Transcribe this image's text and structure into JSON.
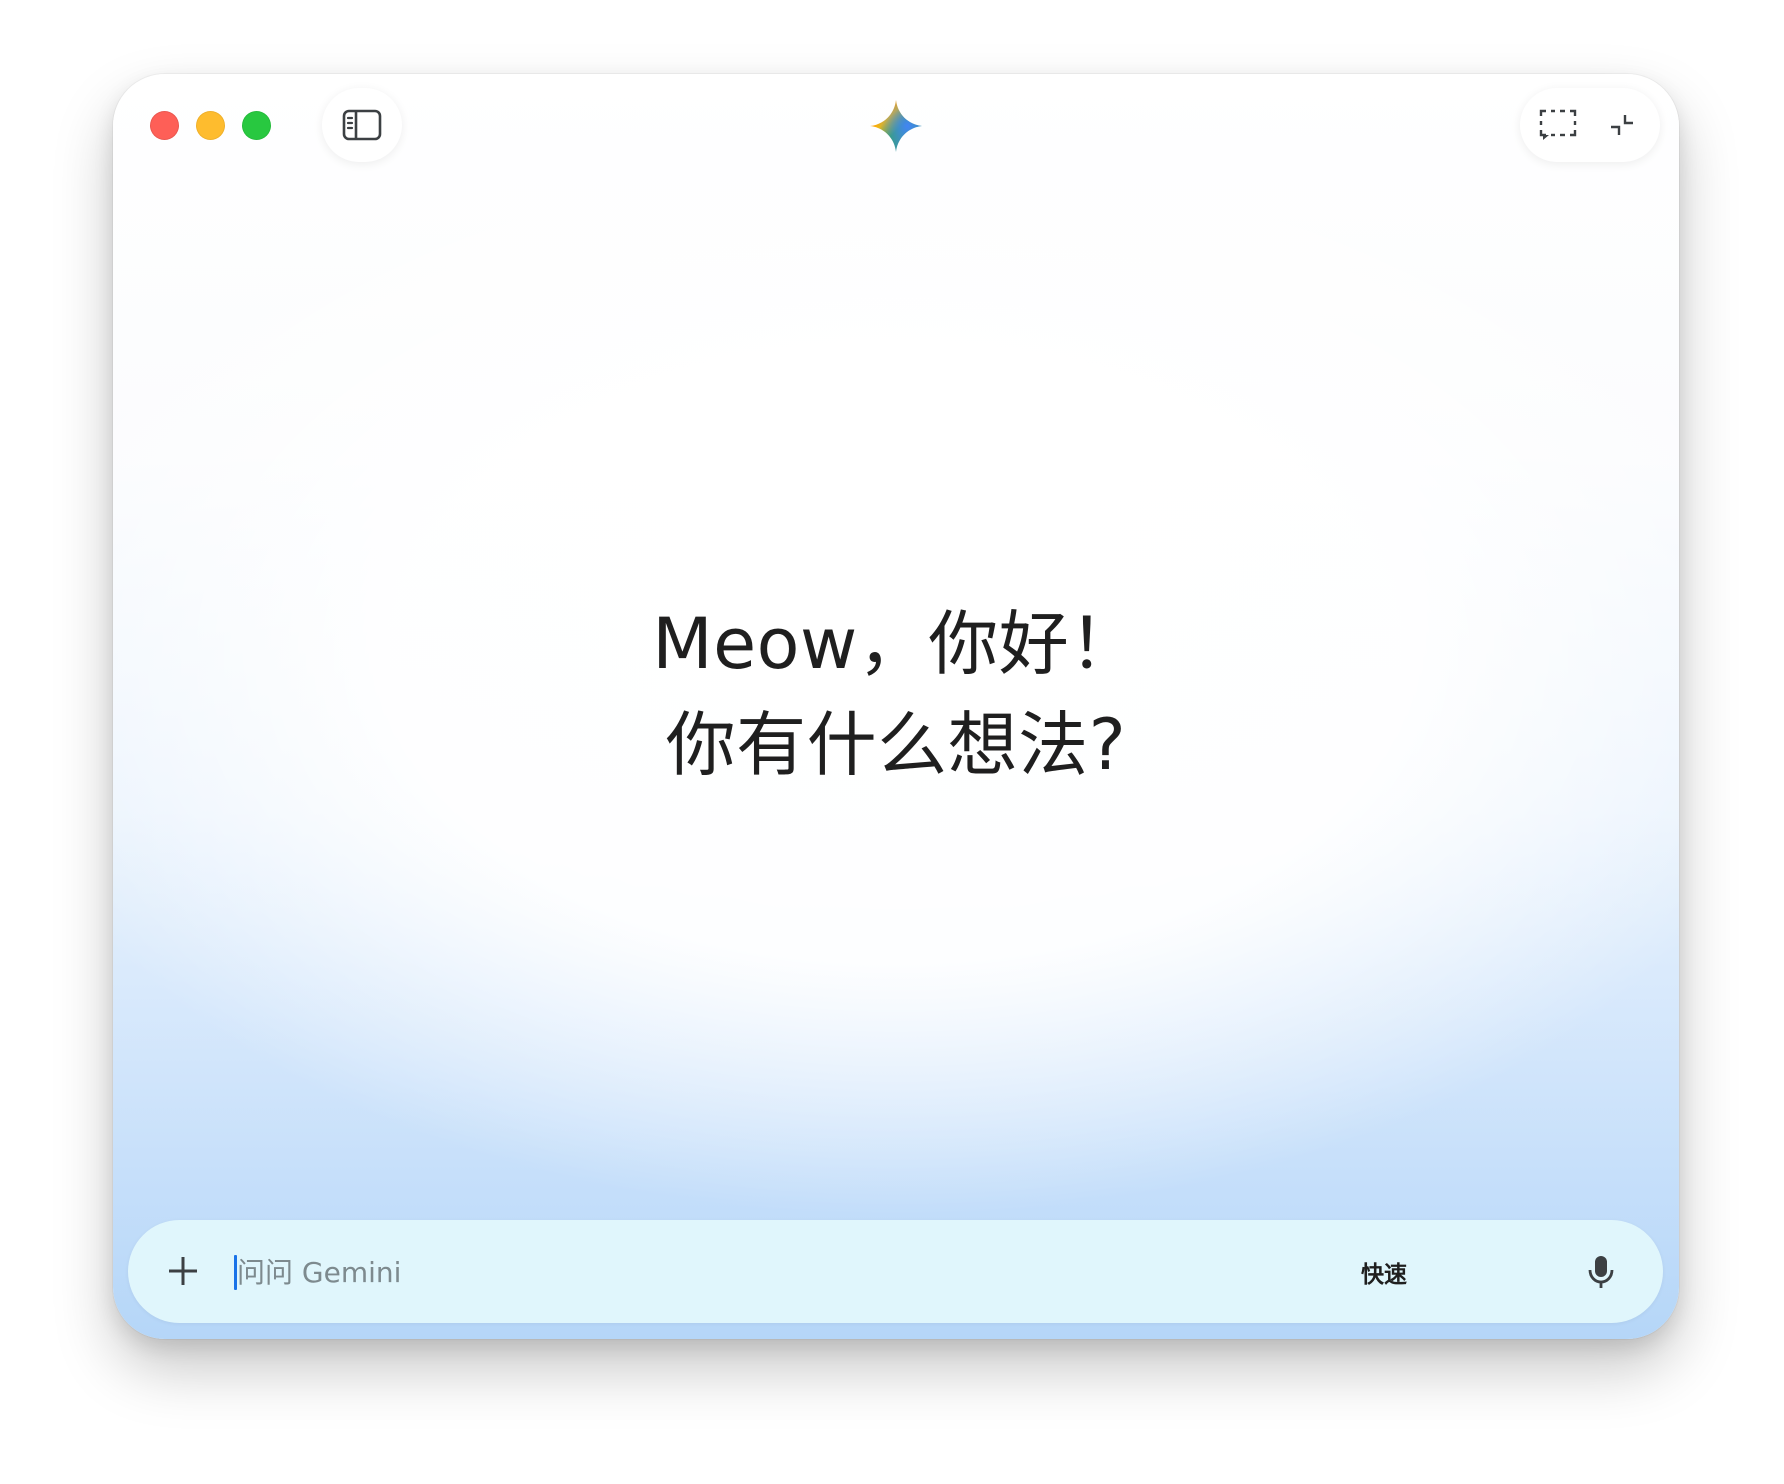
{
  "window": {
    "controls": {
      "close": "close",
      "minimize": "minimize",
      "zoom": "zoom"
    },
    "toolbar": {
      "sidebar_icon": "sidebar-icon",
      "logo_icon": "gemini-spark-icon",
      "screenshot_icon": "screenshot-select-icon",
      "collapse_icon": "collapse-icon"
    }
  },
  "greeting": {
    "line1": "Meow，你好！",
    "line2": "你有什么想法?"
  },
  "composer": {
    "add_icon": "plus-icon",
    "placeholder": "问问 Gemini",
    "value": "",
    "mode_label": "快速",
    "mic_icon": "microphone-icon"
  },
  "colors": {
    "close": "#fe5f57",
    "minimize": "#febc2e",
    "zoom": "#28c840",
    "caret": "#1a73e8",
    "composer_bg": "#e0f6fc"
  }
}
